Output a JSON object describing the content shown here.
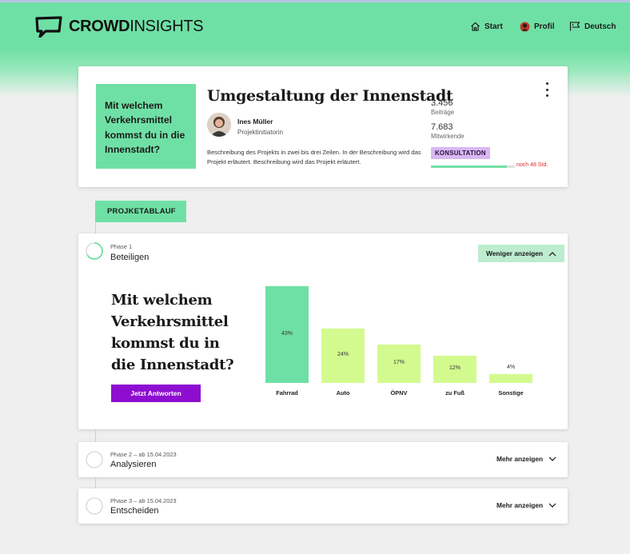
{
  "brand": {
    "name_bold": "CROWD",
    "name_light": "INSIGHTS"
  },
  "nav": {
    "start": "Start",
    "profile": "Profil",
    "language": "Deutsch"
  },
  "project": {
    "question": "Mit welchem Verkehrsmittel kommst du in die Innenstadt?",
    "title": "Umgestaltung der Innenstadt",
    "person_name": "Ines Müller",
    "person_role": "Projektinitiatorin",
    "description": "Beschreibung des Projekts in zwei bis drei Zeilen. In der Beschreibung wird das Projekt erläutert. Beschreibung wird das Projekt erläutert.",
    "contributions_value": "3.456",
    "contributions_label": "Beiträge",
    "participants_value": "7.683",
    "participants_label": "Mitwirkende",
    "status_badge": "KONSULTATION",
    "remaining": "noch 48 Std.",
    "progress": 0.9
  },
  "timeline_tab": "PROJKETABLAUF",
  "phases": [
    {
      "sub": "Phase 1",
      "name": "Beteiligen",
      "toggle": "Weniger anzeigen"
    },
    {
      "sub": "Phase 2 – ab 15.04.2023",
      "name": "Analysieren",
      "toggle": "Mehr anzeigen"
    },
    {
      "sub": "Phase 3 – ab 15.04.2023",
      "name": "Entscheiden",
      "toggle": "Mehr anzeigen"
    }
  ],
  "poll": {
    "question_lines": [
      "Mit welchem",
      "Verkehrsmittel",
      "kommst du in",
      "die Innenstadt?"
    ],
    "cta": "Jetzt Antworten"
  },
  "chart_data": {
    "type": "bar",
    "categories": [
      "Fahrrad",
      "Auto",
      "ÖPNV",
      "zu Fuß",
      "Sonstige"
    ],
    "values": [
      43,
      24,
      17,
      12,
      4
    ],
    "value_labels": [
      "43%",
      "24%",
      "17%",
      "12%",
      "4%"
    ],
    "ylim": [
      0,
      43
    ],
    "grid": false,
    "colors": [
      "#6fe0a5",
      "#d3fa8f",
      "#d3fa8f",
      "#d3fa8f",
      "#d3fa8f"
    ]
  },
  "colors": {
    "accent": "#6fe0a5",
    "cta": "#8d0ed0",
    "badge": "#d9b8f2",
    "danger": "#d82a2a"
  }
}
